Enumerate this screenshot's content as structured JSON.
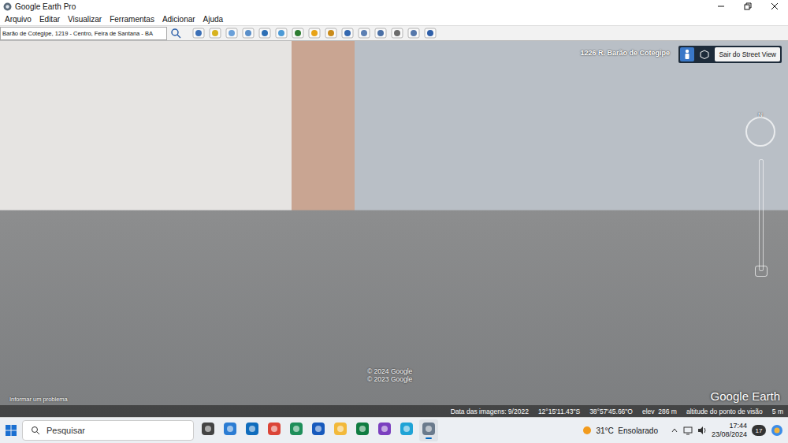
{
  "window": {
    "title": "Google Earth Pro"
  },
  "menu": [
    {
      "label": "Arquivo"
    },
    {
      "label": "Editar"
    },
    {
      "label": "Visualizar"
    },
    {
      "label": "Ferramentas"
    },
    {
      "label": "Adicionar"
    },
    {
      "label": "Ajuda"
    }
  ],
  "search": {
    "value": "Barão de Cotegipe, 1219 - Centro, Feira de Santana - BA"
  },
  "street_view": {
    "address": "1226 R. Barão de Cotegipe",
    "exit_button": "Sair do Street View",
    "compass": "N",
    "copyright": [
      "© 2024 Google",
      "© 2023 Google"
    ],
    "logo": "Google Earth",
    "report_link": "Informar um problema"
  },
  "status_bar": {
    "image_date": "Data das imagens: 9/2022",
    "latitude": "12°15'11.43\"S",
    "longitude": "38°57'45.66\"O",
    "elevation": "elev  286 m",
    "eye_label": "altitude do ponto de visão",
    "eye_value": "5 m"
  },
  "taskbar": {
    "search_placeholder": "Pesquisar",
    "apps": [
      {
        "name": "task-view",
        "selected": false,
        "color": "#444444"
      },
      {
        "name": "store",
        "selected": false,
        "color": "#2b7cd3"
      },
      {
        "name": "mail",
        "selected": false,
        "color": "#0f6cbd"
      },
      {
        "name": "chrome",
        "selected": false,
        "color": "#db4437"
      },
      {
        "name": "app",
        "selected": false,
        "color": "#1e8e5a"
      },
      {
        "name": "word",
        "selected": false,
        "color": "#185abd"
      },
      {
        "name": "explorer",
        "selected": false,
        "color": "#f2b93b"
      },
      {
        "name": "excel",
        "selected": false,
        "color": "#107c41"
      },
      {
        "name": "app2",
        "selected": false,
        "color": "#7b3fbf"
      },
      {
        "name": "edge",
        "selected": false,
        "color": "#1fa3d6"
      },
      {
        "name": "google-earth",
        "selected": true,
        "color": "#6a7a8c"
      }
    ],
    "weather": "31°C  Ensolarado",
    "time": "17:44",
    "date": "23/08/2024",
    "badge": "17"
  }
}
